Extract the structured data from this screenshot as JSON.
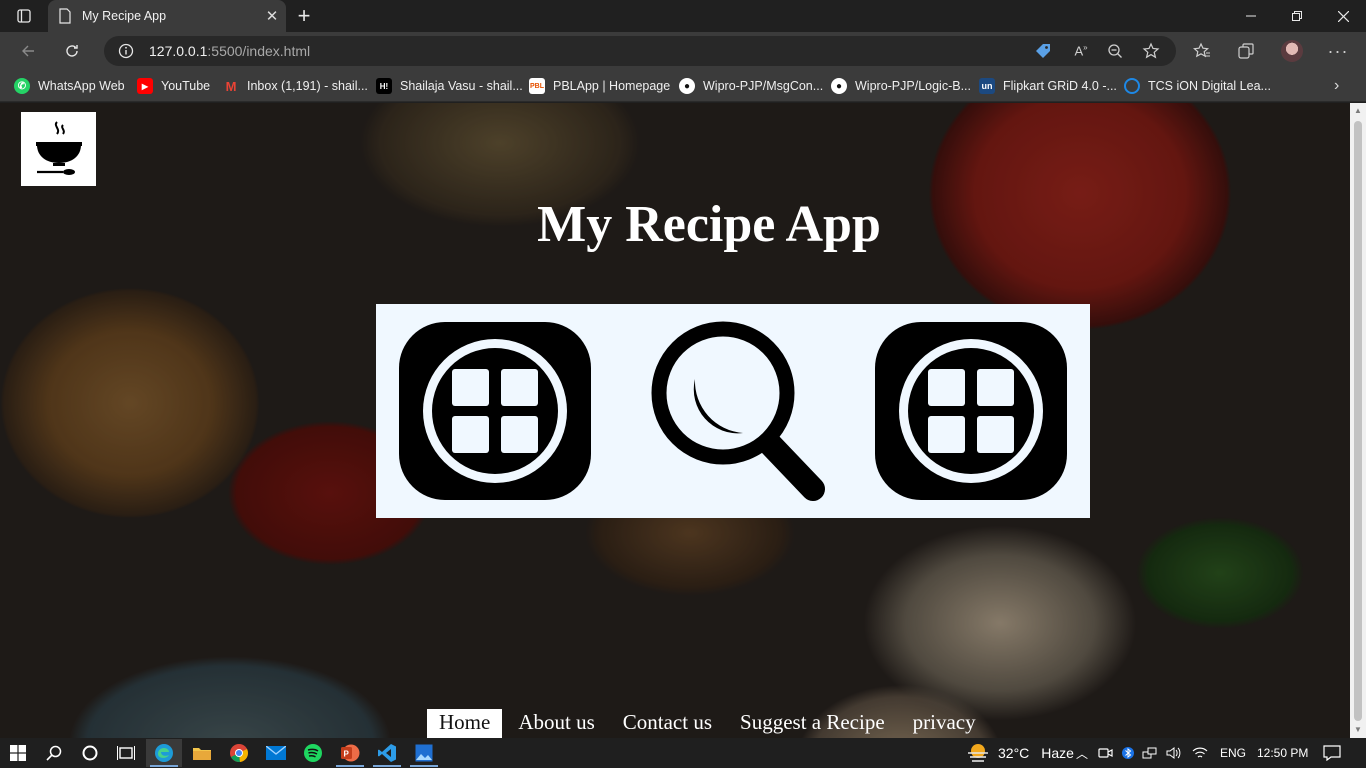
{
  "browser": {
    "tab_title": "My Recipe App",
    "url_host": "127.0.0.1",
    "url_rest": ":5500/index.html",
    "bookmarks": [
      {
        "label": "WhatsApp Web",
        "icon": "whatsapp-icon",
        "color": "#25d366"
      },
      {
        "label": "YouTube",
        "icon": "youtube-icon",
        "color": "#ff0000"
      },
      {
        "label": "Inbox (1,191) - shail...",
        "icon": "gmail-icon",
        "color": "#ea4335"
      },
      {
        "label": "Shailaja Vasu - shail...",
        "icon": "hackerearth-icon",
        "color": "#000000"
      },
      {
        "label": "PBLApp | Homepage",
        "icon": "pbl-icon",
        "color": "#ffffff"
      },
      {
        "label": "Wipro-PJP/MsgCon...",
        "icon": "github-icon",
        "color": "#ffffff"
      },
      {
        "label": "Wipro-PJP/Logic-B...",
        "icon": "github-icon",
        "color": "#ffffff"
      },
      {
        "label": "Flipkart GRiD 4.0 -...",
        "icon": "unstop-icon",
        "color": "#1c4980"
      },
      {
        "label": "TCS iON Digital Lea...",
        "icon": "tcs-icon",
        "color": "#1e88e5"
      }
    ]
  },
  "page": {
    "title": "My Recipe App",
    "logo_icon": "soup-bowl-icon",
    "features": [
      {
        "icon": "grid-icon"
      },
      {
        "icon": "search-icon"
      },
      {
        "icon": "grid-icon"
      }
    ],
    "nav": [
      {
        "label": "Home",
        "active": true
      },
      {
        "label": "About us",
        "active": false
      },
      {
        "label": "Contact us",
        "active": false
      },
      {
        "label": "Suggest a Recipe",
        "active": false
      },
      {
        "label": "privacy",
        "active": false
      }
    ]
  },
  "taskbar": {
    "weather_temp": "32°C",
    "weather_desc": "Haze",
    "language": "ENG",
    "time": "12:50 PM"
  }
}
